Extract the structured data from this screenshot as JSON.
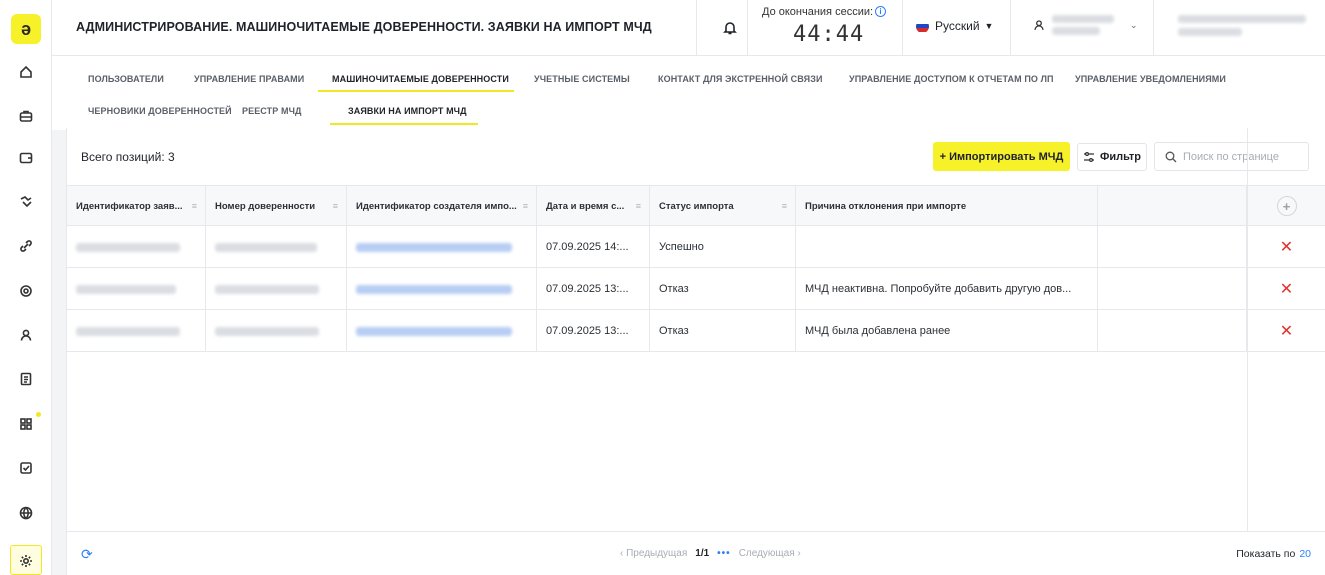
{
  "app": {
    "logo_letter": "ə"
  },
  "header": {
    "title": "АДМИНИСТРИРОВАНИЕ. МАШИНОЧИТАЕМЫЕ ДОВЕРЕННОСТИ. ЗАЯВКИ НА ИМПОРТ МЧД",
    "session_label": "До окончания сессии:",
    "session_timer": "44:44",
    "language": "Русский"
  },
  "sidebar": {
    "icons": [
      "home-icon",
      "briefcase-icon",
      "wallet-icon",
      "handshake-icon",
      "link-icon",
      "fingerprint-icon",
      "user-icon",
      "document-icon",
      "grid-icon",
      "checkbox-icon",
      "globe-icon",
      "settings-icon"
    ]
  },
  "tabs": {
    "row1": [
      "ПОЛЬЗОВАТЕЛИ",
      "УПРАВЛЕНИЕ ПРАВАМИ",
      "МАШИНОЧИТАЕМЫЕ ДОВЕРЕННОСТИ",
      "УЧЕТНЫЕ СИСТЕМЫ",
      "КОНТАКТ ДЛЯ ЭКСТРЕННОЙ СВЯЗИ",
      "УПРАВЛЕНИЕ ДОСТУПОМ К ОТЧЕТАМ ПО ЛП",
      "УПРАВЛЕНИЕ УВЕДОМЛЕНИЯМИ"
    ],
    "row2": [
      "ЧЕРНОВИКИ ДОВЕРЕННОСТЕЙ",
      "РЕЕСТР МЧД",
      "ЗАЯВКИ НА ИМПОРТ МЧД"
    ],
    "active_row1": "МАШИНОЧИТАЕМЫЕ ДОВЕРЕННОСТИ",
    "active_row2": "ЗАЯВКИ НА ИМПОРТ МЧД"
  },
  "toolbar": {
    "total_label": "Всего позиций: 3",
    "import_label": "+ Импортировать МЧД",
    "filter_label": "Фильтр",
    "search_placeholder": "Поиск по странице"
  },
  "table": {
    "columns": [
      "Идентификатор заяв...",
      "Номер доверенности",
      "Идентификатор создателя импо...",
      "Дата и время с...",
      "Статус импорта",
      "Причина отклонения при импорте"
    ],
    "rows": [
      {
        "date": "07.09.2025 14:...",
        "status": "Успешно",
        "reason": ""
      },
      {
        "date": "07.09.2025 13:...",
        "status": "Отказ",
        "reason": "МЧД неактивна. Попробуйте добавить другую дов..."
      },
      {
        "date": "07.09.2025 13:...",
        "status": "Отказ",
        "reason": "МЧД была добавлена ранее"
      }
    ]
  },
  "footer": {
    "prev": "Предыдущая",
    "page": "1/1",
    "next": "Следующая",
    "show_label": "Показать по",
    "page_size": "20"
  },
  "colors": {
    "accent": "#f7f12a",
    "link": "#2d7ff9",
    "danger": "#e0342f"
  }
}
